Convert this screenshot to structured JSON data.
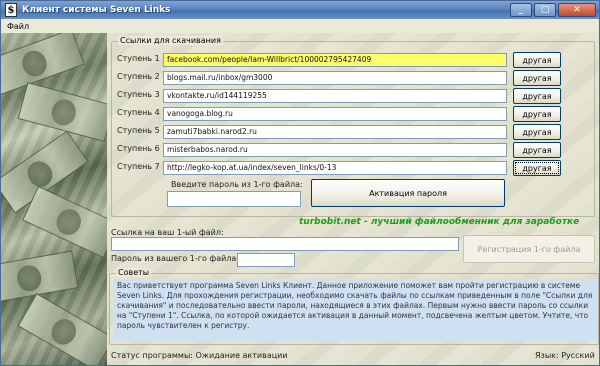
{
  "window": {
    "title": "Клиент системы Seven Links",
    "app_icon": "$"
  },
  "menu": {
    "file": "Файл"
  },
  "links_group": {
    "title": "Ссылки для скачивания",
    "steps": [
      {
        "label": "Ступень 1",
        "url": "facebook.com/people/Iam-Willbrict/100002795427409",
        "button": "другая",
        "highlighted": true
      },
      {
        "label": "Ступень 2",
        "url": "blogs.mail.ru/inbox/gm3000",
        "button": "другая"
      },
      {
        "label": "Ступень 3",
        "url": "vkontakte.ru/id144119255",
        "button": "другая"
      },
      {
        "label": "Ступень 4",
        "url": "vanogoga.blog.ru",
        "button": "другая"
      },
      {
        "label": "Ступень 5",
        "url": "zamuti7babki.narod2.ru",
        "button": "другая"
      },
      {
        "label": "Ступень 6",
        "url": "misterbabos.narod.ru",
        "button": "другая"
      },
      {
        "label": "Ступень 7",
        "url": "http://legko-kop.at.ua/index/seven_links/0-13",
        "button": "другая"
      }
    ],
    "password_prompt": "Введите пароль из 1-го файла:",
    "password_value": "",
    "activate_button": "Активация пароля"
  },
  "promo_text": "turbobit.net - лучший файлообменник для заработке",
  "file_link_label": "Ссылка на ваш 1-ый файл:",
  "file_link_value": "",
  "file_password_label": "Пароль из вашего 1-го файла:",
  "file_password_value": "",
  "register_button": "Регистрация 1-го файла",
  "tips": {
    "title": "Советы",
    "text": "Вас приветствует программа Seven Links Клиент. Данное приложение поможет вам пройти регистрацию в системе Seven Links. Для прохождения регистрации, необходимо скачать файлы по ссылкам приведенным в поле \"Ссылки для скачивания\" и последовательно ввести пароли, находящиеся в этих файлах. Первым нужно ввести пароль со ссылки на \"Ступени 1\". Ссылка, по которой ожидается активация в данный момент, подсвечена желтым цветом. Учтите, что пароль чувствителен к регистру."
  },
  "status": {
    "text": "Статус программы: Ожидание активации",
    "language": "Язык: Русский"
  },
  "colors": {
    "highlight": "#fdfd6b",
    "promo": "#19a019",
    "tips_bg": "#cfe0f3"
  }
}
